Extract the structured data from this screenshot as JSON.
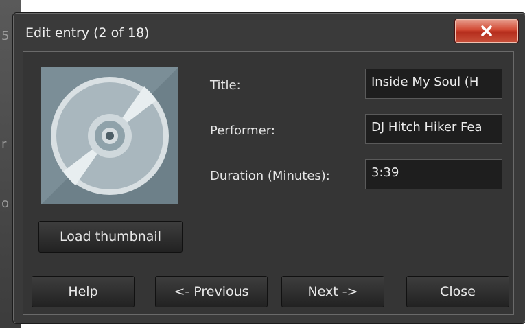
{
  "window": {
    "title": "Edit entry (2 of 18)",
    "close_icon": "close-x-icon",
    "close_color": "#c8402c"
  },
  "thumbnail": {
    "icon": "cd-disc-icon",
    "load_label": "Load thumbnail"
  },
  "fields": {
    "title_label": "Title:",
    "title_value": "Inside My Soul (H",
    "performer_label": "Performer:",
    "performer_value": "DJ Hitch Hiker Fea",
    "duration_label": "Duration (Minutes):",
    "duration_value": "3:39"
  },
  "buttons": {
    "help": "Help",
    "previous": "<- Previous",
    "next": "Next ->",
    "close": "Close"
  }
}
